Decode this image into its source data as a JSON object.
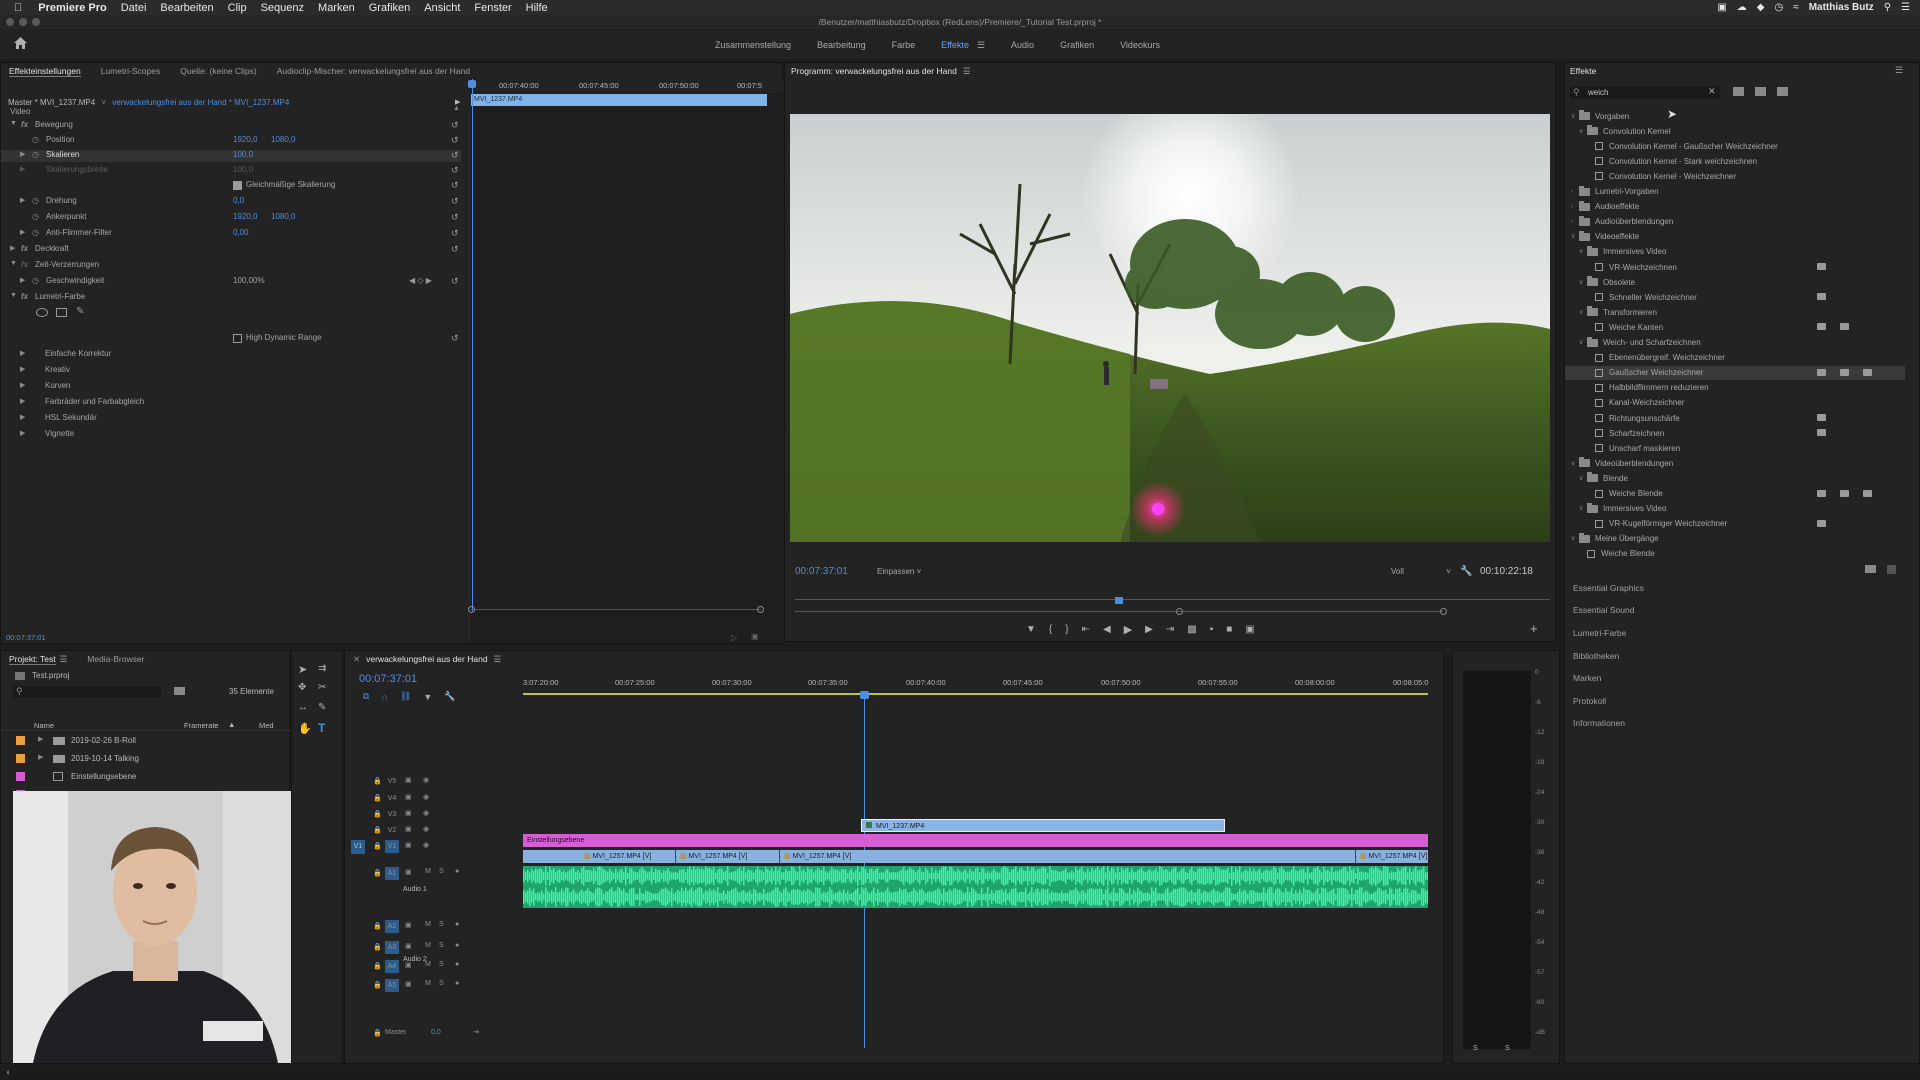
{
  "menubar": {
    "app_name": "Premiere Pro",
    "items": [
      "Datei",
      "Bearbeiten",
      "Clip",
      "Sequenz",
      "Marken",
      "Grafiken",
      "Ansicht",
      "Fenster",
      "Hilfe"
    ],
    "user": "Matthias Butz"
  },
  "window_title": "/Benutzer/matthiasbutz/Dropbox (RedLens)/Premiere/_Tutorial Test.prproj *",
  "workspaces": [
    "Zusammenstellung",
    "Bearbeitung",
    "Farbe",
    "Effekte",
    "Audio",
    "Grafiken",
    "Videokurs"
  ],
  "active_workspace": "Effekte",
  "effect_controls": {
    "tabs": [
      "Effekteinstellungen",
      "Lumetri-Scopes",
      "Quelle: (keine Clips)",
      "Audioclip-Mischer: verwackelungsfrei aus der Hand"
    ],
    "master_label": "Master * MVI_1237.MP4",
    "clip_label": "verwackelungsfrei aus der Hand * MVI_1237.MP4",
    "ruler": [
      "00:07:40:00",
      "00:07:45:00",
      "00:07:50:00",
      "00:07:5"
    ],
    "clip_bar": "MVI_1237.MP4",
    "section_video": "Video",
    "bewegung": "Bewegung",
    "position_label": "Position",
    "position_x": "1920,0",
    "position_y": "1080,0",
    "skalieren_label": "Skalieren",
    "skalieren_val": "100,0",
    "skalierungsbreite_label": "Skalierungsbreite",
    "skalierungsbreite_val": "100,0",
    "gleichmaessig": "Gleichmäßige Skalierung",
    "drehung_label": "Drehung",
    "drehung_val": "0,0",
    "ankerpunkt_label": "Ankerpunkt",
    "ankerpunkt_x": "1920,0",
    "ankerpunkt_y": "1080,0",
    "antiflimmer_label": "Anti-Flimmer-Filter",
    "antiflimmer_val": "0,00",
    "deckkraft": "Deckkraft",
    "zeitverzerrungen": "Zeit-Verzerrungen",
    "geschwindigkeit_label": "Geschwindigkeit",
    "geschwindigkeit_val": "100,00%",
    "lumetri": "Lumetri-Farbe",
    "hdr": "High Dynamic Range",
    "lumetri_sections": [
      "Einfache Korrektur",
      "Kreativ",
      "Kurven",
      "Farbräder und Farbabgleich",
      "HSL Sekundär",
      "Vignette"
    ],
    "timecode": "00:07:37:01"
  },
  "program": {
    "title": "Programm: verwackelungsfrei aus der Hand",
    "timecode": "00:07:37:01",
    "fit": "Einpassen",
    "quality": "Voll",
    "duration": "00:10:22:18"
  },
  "effects_panel": {
    "title": "Effekte",
    "search_value": "weich",
    "tree": [
      {
        "label": "Vorgaben",
        "level": 0,
        "type": "folder",
        "open": true
      },
      {
        "label": "Convolution Kernel",
        "level": 1,
        "type": "folder",
        "open": true
      },
      {
        "label": "Convolution Kernel - Gaußscher Weichzeichner",
        "level": 2,
        "type": "fx"
      },
      {
        "label": "Convolution Kernel - Stark weichzeichnen",
        "level": 2,
        "type": "fx"
      },
      {
        "label": "Convolution Kernel - Weichzeichner",
        "level": 2,
        "type": "fx"
      },
      {
        "label": "Lumetri-Vorgaben",
        "level": 0,
        "type": "folder"
      },
      {
        "label": "Audioeffekte",
        "level": 0,
        "type": "folder"
      },
      {
        "label": "Audioüberblendungen",
        "level": 0,
        "type": "folder"
      },
      {
        "label": "Videoeffekte",
        "level": 0,
        "type": "folder",
        "open": true
      },
      {
        "label": "Immersives Video",
        "level": 1,
        "type": "folder",
        "open": true
      },
      {
        "label": "VR-Weichzeichnen",
        "level": 2,
        "type": "fx",
        "badges": 1
      },
      {
        "label": "Obsolete",
        "level": 1,
        "type": "folder",
        "open": true
      },
      {
        "label": "Schneller Weichzeichner",
        "level": 2,
        "type": "fx",
        "badges": 1
      },
      {
        "label": "Transformieren",
        "level": 1,
        "type": "folder",
        "open": true
      },
      {
        "label": "Weiche Kanten",
        "level": 2,
        "type": "fx",
        "badges": 2
      },
      {
        "label": "Weich- und Scharfzeichnen",
        "level": 1,
        "type": "folder",
        "open": true
      },
      {
        "label": "Ebenenübergreif. Weichzeichner",
        "level": 2,
        "type": "fx"
      },
      {
        "label": "Gaußscher Weichzeichner",
        "level": 2,
        "type": "fx",
        "badges": 3,
        "selected": true
      },
      {
        "label": "Halbbildflimmern reduzieren",
        "level": 2,
        "type": "fx"
      },
      {
        "label": "Kanal-Weichzeichner",
        "level": 2,
        "type": "fx"
      },
      {
        "label": "Richtungsunschärfe",
        "level": 2,
        "type": "fx",
        "badges": 1
      },
      {
        "label": "Scharfzeichnen",
        "level": 2,
        "type": "fx",
        "badges": 1
      },
      {
        "label": "Unscharf maskieren",
        "level": 2,
        "type": "fx"
      },
      {
        "label": "Videoüberblendungen",
        "level": 0,
        "type": "folder",
        "open": true
      },
      {
        "label": "Blende",
        "level": 1,
        "type": "folder",
        "open": true
      },
      {
        "label": "Weiche Blende",
        "level": 2,
        "type": "fx",
        "badges": 3
      },
      {
        "label": "Immersives Video",
        "level": 1,
        "type": "folder",
        "open": true
      },
      {
        "label": "VR-Kugelförmiger Weichzeichner",
        "level": 2,
        "type": "fx",
        "badges": 1
      },
      {
        "label": "Meine Übergänge",
        "level": 0,
        "type": "folder",
        "open": true
      },
      {
        "label": "Weiche Blende",
        "level": 1,
        "type": "fx"
      }
    ],
    "side_panels": [
      "Essential Graphics",
      "Essential Sound",
      "Lumetri-Farbe",
      "Bibliotheken",
      "Marken",
      "Protokoll",
      "Informationen"
    ]
  },
  "project": {
    "tabs": [
      "Projekt: Test",
      "Media-Browser"
    ],
    "file": "Test.prproj",
    "count": "35 Elemente",
    "col_name": "Name",
    "col_framerate": "Framerate",
    "col_med": "Med",
    "items": [
      "2019-02-26 B-Roll",
      "2019-10-14 Talking",
      "Einstellungsebene"
    ]
  },
  "timeline": {
    "title": "verwackelungsfrei aus der Hand",
    "timecode": "00:07:37:01",
    "ruler": [
      "3:07:20:00",
      "00:07:25:00",
      "00:07:30:00",
      "00:07:35:00",
      "00:07:40:00",
      "00:07:45:00",
      "00:07:50:00",
      "00:07:55:00",
      "00:08:00:00",
      "00:08:05:0"
    ],
    "video_tracks": [
      "V5",
      "V4",
      "V3",
      "V2",
      "V1"
    ],
    "audio_tracks": [
      "A1",
      "A2",
      "A3",
      "A4",
      "A5"
    ],
    "audio1_name": "Audio 1",
    "audio2_name": "Audio 2",
    "master_label": "Master",
    "master_val": "0,0",
    "clip_v3": "MVI_1237.MP4",
    "clip_adjust": "Einstellungsebene",
    "clips_v1": [
      "MVI_1257.MP4 [V]",
      "MVI_1257.MP4 [V]",
      "MVI_1257.MP4 [V]",
      "MVI_1257.MP4 [V]"
    ]
  },
  "meters": {
    "scale": [
      "0",
      "-6",
      "-12",
      "-18",
      "-24",
      "-30",
      "-36",
      "-42",
      "-48",
      "-54",
      "-57",
      "-60",
      "-dB"
    ],
    "footer": [
      "S",
      "S"
    ]
  },
  "colors": {
    "accent": "#4c8fe0",
    "adjustment_clip": "#d45fd4",
    "video_clip": "#8ab0e0",
    "audio_clip": "#2ec98a"
  }
}
